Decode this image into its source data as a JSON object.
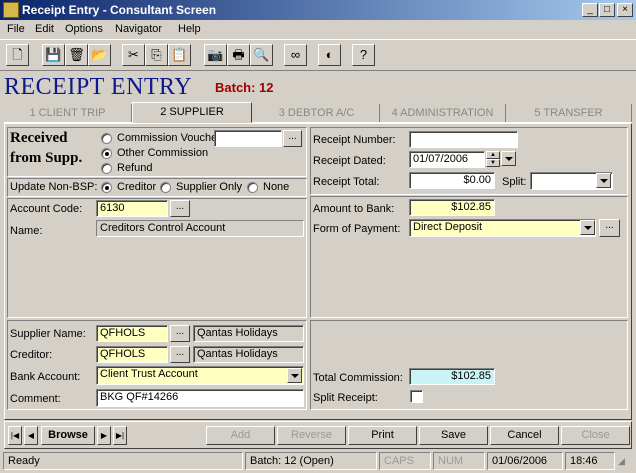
{
  "window": {
    "title": "Receipt Entry - Consultant Screen",
    "min_glyph": "_",
    "max_glyph": "□",
    "close_glyph": "×"
  },
  "menu": [
    "File",
    "Edit",
    "Options",
    "Navigator",
    "Help"
  ],
  "toolbar": {
    "icons": [
      "new-document-icon",
      "save-icon",
      "delete-icon",
      "folder-icon",
      "cut-icon",
      "copy-icon",
      "paste-icon",
      "camera-icon",
      "print-icon",
      "print-preview-icon",
      "binoculars-icon",
      "globe-icon",
      "help-icon"
    ],
    "glyphs": [
      "🗋",
      "💾",
      "🗑",
      "📂",
      "✂",
      "⎘",
      "📋",
      "📷",
      "🖶",
      "🔍",
      "∞",
      "◐",
      "?"
    ]
  },
  "header": {
    "title": "RECEIPT ENTRY",
    "batch": "Batch: 12"
  },
  "tabs": [
    {
      "num": "1",
      "label": "CLIENT TRIP"
    },
    {
      "num": "2",
      "label": "SUPPLIER"
    },
    {
      "num": "3",
      "label": "DEBTOR A/C"
    },
    {
      "num": "4",
      "label": "ADMINISTRATION"
    },
    {
      "num": "5",
      "label": "TRANSFER"
    }
  ],
  "left": {
    "received_from_line1": "Received",
    "received_from_line2": "from Supp.",
    "options": {
      "commission_voucher": "Commission Voucher",
      "other_commission": "Other Commission",
      "refund": "Refund"
    },
    "commission_voucher_value": "",
    "update_non_bsp_label": "Update Non-BSP:",
    "update_options": {
      "creditor": "Creditor",
      "supplier_only": "Supplier Only",
      "none": "None"
    },
    "account_code_label": "Account Code:",
    "account_code_value": "6130",
    "name_label": "Name:",
    "name_value": "Creditors Control Account",
    "supplier_name_label": "Supplier Name:",
    "supplier_code": "QFHOLS",
    "supplier_desc": "Qantas Holidays",
    "creditor_label": "Creditor:",
    "creditor_code": "QFHOLS",
    "creditor_desc": "Qantas Holidays",
    "bank_account_label": "Bank Account:",
    "bank_account_value": "Client Trust Account",
    "comment_label": "Comment:",
    "comment_value": "BKG QF#14266",
    "ellipsis": "..."
  },
  "right": {
    "receipt_number_label": "Receipt Number:",
    "receipt_number_value": "",
    "receipt_dated_label": "Receipt Dated:",
    "receipt_dated_value": "01/07/2006",
    "receipt_total_label": "Receipt Total:",
    "receipt_total_value": "$0.00",
    "split_label": "Split:",
    "split_value": "",
    "amount_to_bank_label": "Amount to Bank:",
    "amount_to_bank_value": "$102.85",
    "form_of_payment_label": "Form of Payment:",
    "form_of_payment_value": "Direct Deposit",
    "total_commission_label": "Total Commission:",
    "total_commission_value": "$102.85",
    "split_receipt_label": "Split Receipt:",
    "split_receipt_checked": false
  },
  "nav": {
    "browse": "Browse",
    "add": "Add",
    "reverse": "Reverse",
    "print": "Print",
    "save": "Save",
    "cancel": "Cancel",
    "close": "Close"
  },
  "status": {
    "state": "Ready",
    "batch": "Batch: 12 (Open)",
    "caps": "CAPS",
    "num": "NUM",
    "date": "01/06/2006",
    "time": "18:46"
  }
}
